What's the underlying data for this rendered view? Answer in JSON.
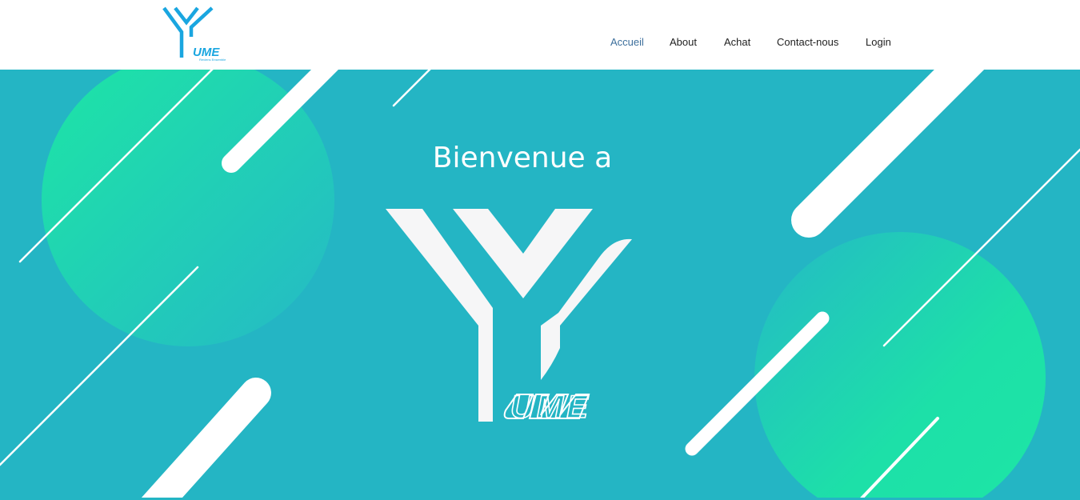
{
  "header": {
    "logo_icon": "yume-logo-icon",
    "logo_text": "UME",
    "logo_tagline": "Reviens Ensemble"
  },
  "nav": {
    "items": [
      {
        "label": "Accueil",
        "active": true
      },
      {
        "label": "About",
        "active": false
      },
      {
        "label": "Achat",
        "active": false
      },
      {
        "label": "Contact-nous",
        "active": false
      },
      {
        "label": "Login",
        "active": false
      }
    ]
  },
  "hero": {
    "title": "Bienvenue a",
    "logo_icon": "yume-hero-logo-icon",
    "logo_text": "UME",
    "background_color": "#24b5c4",
    "accent_color": "#1ee0a6"
  }
}
